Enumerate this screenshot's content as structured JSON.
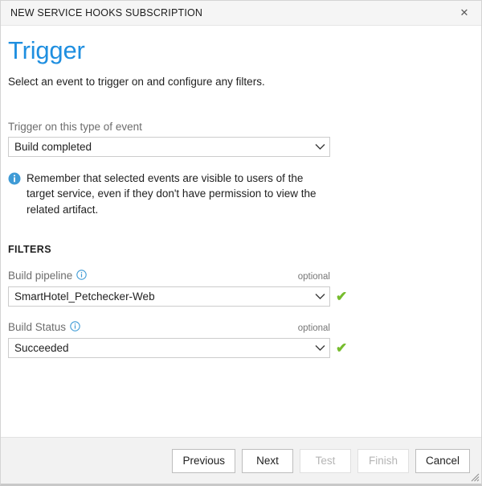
{
  "window": {
    "title": "NEW SERVICE HOOKS SUBSCRIPTION",
    "close_icon": "close-icon",
    "close_glyph": "✕"
  },
  "page": {
    "title": "Trigger",
    "subtitle": "Select an event to trigger on and configure any filters.",
    "title_color": "#1f8fe0"
  },
  "event": {
    "label": "Trigger on this type of event",
    "selected": "Build completed",
    "options": [
      "Build completed"
    ]
  },
  "info": {
    "icon": "info-circle-filled-icon",
    "glyph": "i",
    "color": "#3f9bd6",
    "message": "Remember that selected events are visible to users of the target service, even if they don't have permission to view the related artifact."
  },
  "filters": {
    "heading": "FILTERS",
    "optional_tag": "optional",
    "valid_icon": "check-icon",
    "valid_glyph": "✔",
    "valid_color": "#76bc2d",
    "help_icon": "info-circle-outline-icon",
    "items": [
      {
        "label": "Build pipeline",
        "selected": "SmartHotel_Petchecker-Web",
        "optional": "optional",
        "valid": true
      },
      {
        "label": "Build Status",
        "selected": "Succeeded",
        "optional": "optional",
        "valid": true
      }
    ]
  },
  "footer": {
    "buttons": [
      {
        "label": "Previous",
        "disabled": false
      },
      {
        "label": "Next",
        "disabled": false
      },
      {
        "label": "Test",
        "disabled": true
      },
      {
        "label": "Finish",
        "disabled": true
      },
      {
        "label": "Cancel",
        "disabled": false
      }
    ]
  }
}
